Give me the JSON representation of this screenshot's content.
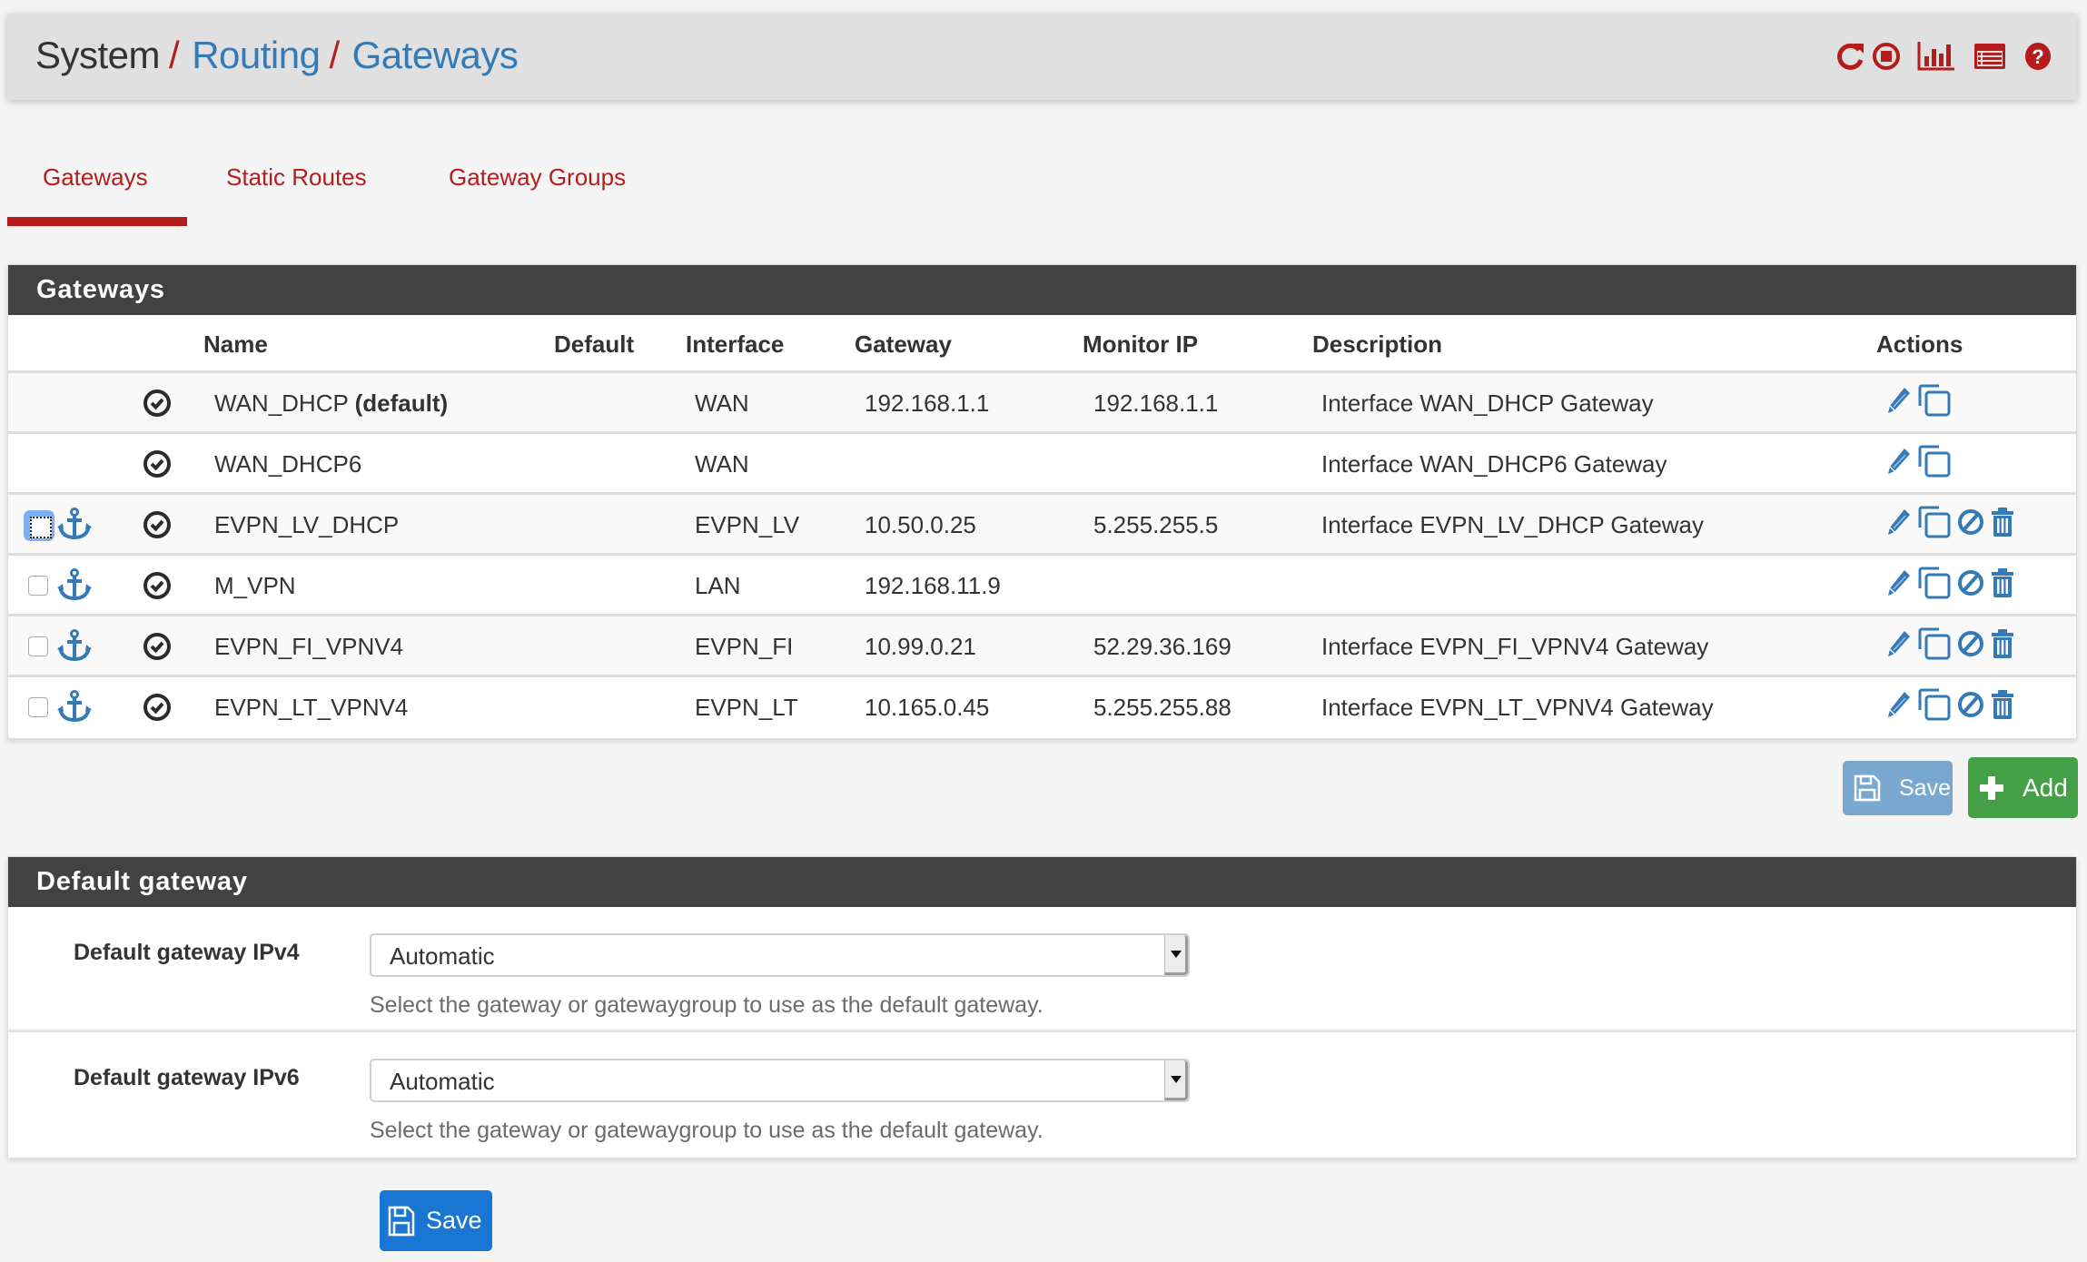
{
  "breadcrumb": {
    "items": [
      {
        "label": "System"
      },
      {
        "label": "Routing"
      },
      {
        "label": "Gateways"
      }
    ],
    "separator": "/"
  },
  "header_icons": [
    {
      "name": "restart-icon"
    },
    {
      "name": "stop-icon"
    },
    {
      "name": "status-chart-icon"
    },
    {
      "name": "log-list-icon"
    },
    {
      "name": "help-icon"
    }
  ],
  "tabs": [
    {
      "label": "Gateways",
      "active": true
    },
    {
      "label": "Static Routes",
      "active": false
    },
    {
      "label": "Gateway Groups",
      "active": false
    }
  ],
  "gateways_panel": {
    "title": "Gateways",
    "columns": [
      "Name",
      "Default",
      "Interface",
      "Gateway",
      "Monitor IP",
      "Description",
      "Actions"
    ],
    "rows": [
      {
        "name": "WAN_DHCP",
        "name_suffix": "(default)",
        "interface": "WAN",
        "gateway": "192.168.1.1",
        "monitor_ip": "192.168.1.1",
        "description": "Interface WAN_DHCP Gateway",
        "selectable": false,
        "actions": [
          "edit",
          "copy"
        ]
      },
      {
        "name": "WAN_DHCP6",
        "name_suffix": "",
        "interface": "WAN",
        "gateway": "",
        "monitor_ip": "",
        "description": "Interface WAN_DHCP6 Gateway",
        "selectable": false,
        "actions": [
          "edit",
          "copy"
        ]
      },
      {
        "name": "EVPN_LV_DHCP",
        "name_suffix": "",
        "interface": "EVPN_LV",
        "gateway": "10.50.0.25",
        "monitor_ip": "5.255.255.5",
        "description": "Interface EVPN_LV_DHCP Gateway",
        "selectable": true,
        "focused": true,
        "checked": false,
        "actions": [
          "edit",
          "copy",
          "disable",
          "delete"
        ]
      },
      {
        "name": "M_VPN",
        "name_suffix": "",
        "interface": "LAN",
        "gateway": "192.168.11.9",
        "monitor_ip": "",
        "description": "",
        "selectable": true,
        "checked": false,
        "actions": [
          "edit",
          "copy",
          "disable",
          "delete"
        ]
      },
      {
        "name": "EVPN_FI_VPNV4",
        "name_suffix": "",
        "interface": "EVPN_FI",
        "gateway": "10.99.0.21",
        "monitor_ip": "52.29.36.169",
        "description": "Interface EVPN_FI_VPNV4 Gateway",
        "selectable": true,
        "checked": false,
        "actions": [
          "edit",
          "copy",
          "disable",
          "delete"
        ]
      },
      {
        "name": "EVPN_LT_VPNV4",
        "name_suffix": "",
        "interface": "EVPN_LT",
        "gateway": "10.165.0.45",
        "monitor_ip": "5.255.255.88",
        "description": "Interface EVPN_LT_VPNV4 Gateway",
        "selectable": true,
        "checked": false,
        "actions": [
          "edit",
          "copy",
          "disable",
          "delete"
        ]
      }
    ],
    "save_label": "Save",
    "add_label": "Add"
  },
  "default_gateway_panel": {
    "title": "Default gateway",
    "fields": [
      {
        "label": "Default gateway IPv4",
        "value": "Automatic",
        "help": "Select the gateway or gatewaygroup to use as the default gateway."
      },
      {
        "label": "Default gateway IPv6",
        "value": "Automatic",
        "help": "Select the gateway or gatewaygroup to use as the default gateway."
      }
    ],
    "save_label": "Save"
  },
  "colors": {
    "accent_red": "#b71c1c",
    "link_blue": "#337ab7",
    "panel_heading": "#424242",
    "add_green": "#43a047",
    "save_blue": "#1976d2",
    "save_blue_disabled": "#7aa7d0"
  }
}
